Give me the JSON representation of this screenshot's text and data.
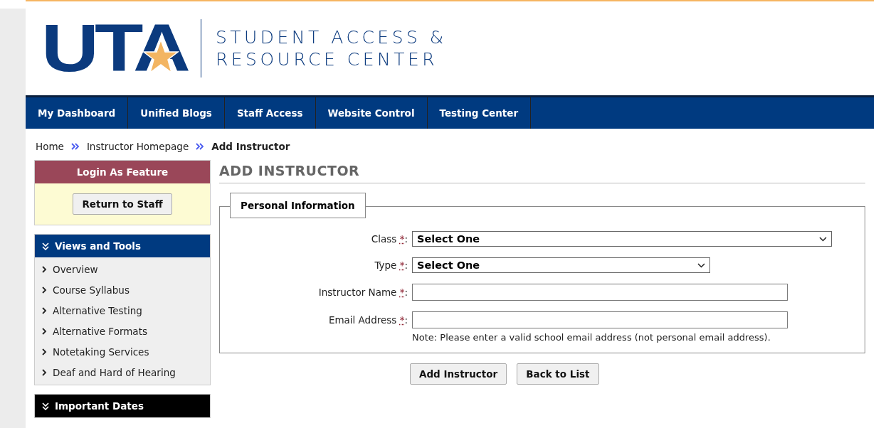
{
  "header": {
    "logo_text": "UTA",
    "title_line_1": "STUDENT ACCESS &",
    "title_line_2": "RESOURCE CENTER"
  },
  "nav": [
    {
      "label": "My Dashboard"
    },
    {
      "label": "Unified Blogs"
    },
    {
      "label": "Staff Access"
    },
    {
      "label": "Website Control"
    },
    {
      "label": "Testing Center"
    }
  ],
  "breadcrumb": [
    {
      "label": "Home",
      "current": false
    },
    {
      "label": "Instructor Homepage",
      "current": false
    },
    {
      "label": "Add Instructor",
      "current": true
    }
  ],
  "sidebar": {
    "login_panel": {
      "title": "Login As Feature",
      "button": "Return to Staff"
    },
    "views_panel": {
      "title": "Views and Tools",
      "items": [
        {
          "label": "Overview"
        },
        {
          "label": "Course Syllabus"
        },
        {
          "label": "Alternative Testing"
        },
        {
          "label": "Alternative Formats"
        },
        {
          "label": "Notetaking Services"
        },
        {
          "label": "Deaf and Hard of Hearing"
        }
      ]
    },
    "dates_panel": {
      "title": "Important Dates"
    }
  },
  "page_title": "ADD INSTRUCTOR",
  "form": {
    "legend": "Personal Information",
    "required_mark": "*",
    "label_suffix": ":",
    "fields": [
      {
        "kind": "wide-select",
        "label": "Class",
        "value": "Select One"
      },
      {
        "kind": "select",
        "label": "Type",
        "value": "Select One"
      },
      {
        "kind": "text",
        "label": "Instructor Name"
      },
      {
        "kind": "text",
        "label": "Email Address",
        "note": "Note: Please enter a valid school email address (not personal email address)."
      }
    ]
  },
  "buttons": [
    {
      "label": "Add Instructor"
    },
    {
      "label": "Back to List"
    }
  ]
}
